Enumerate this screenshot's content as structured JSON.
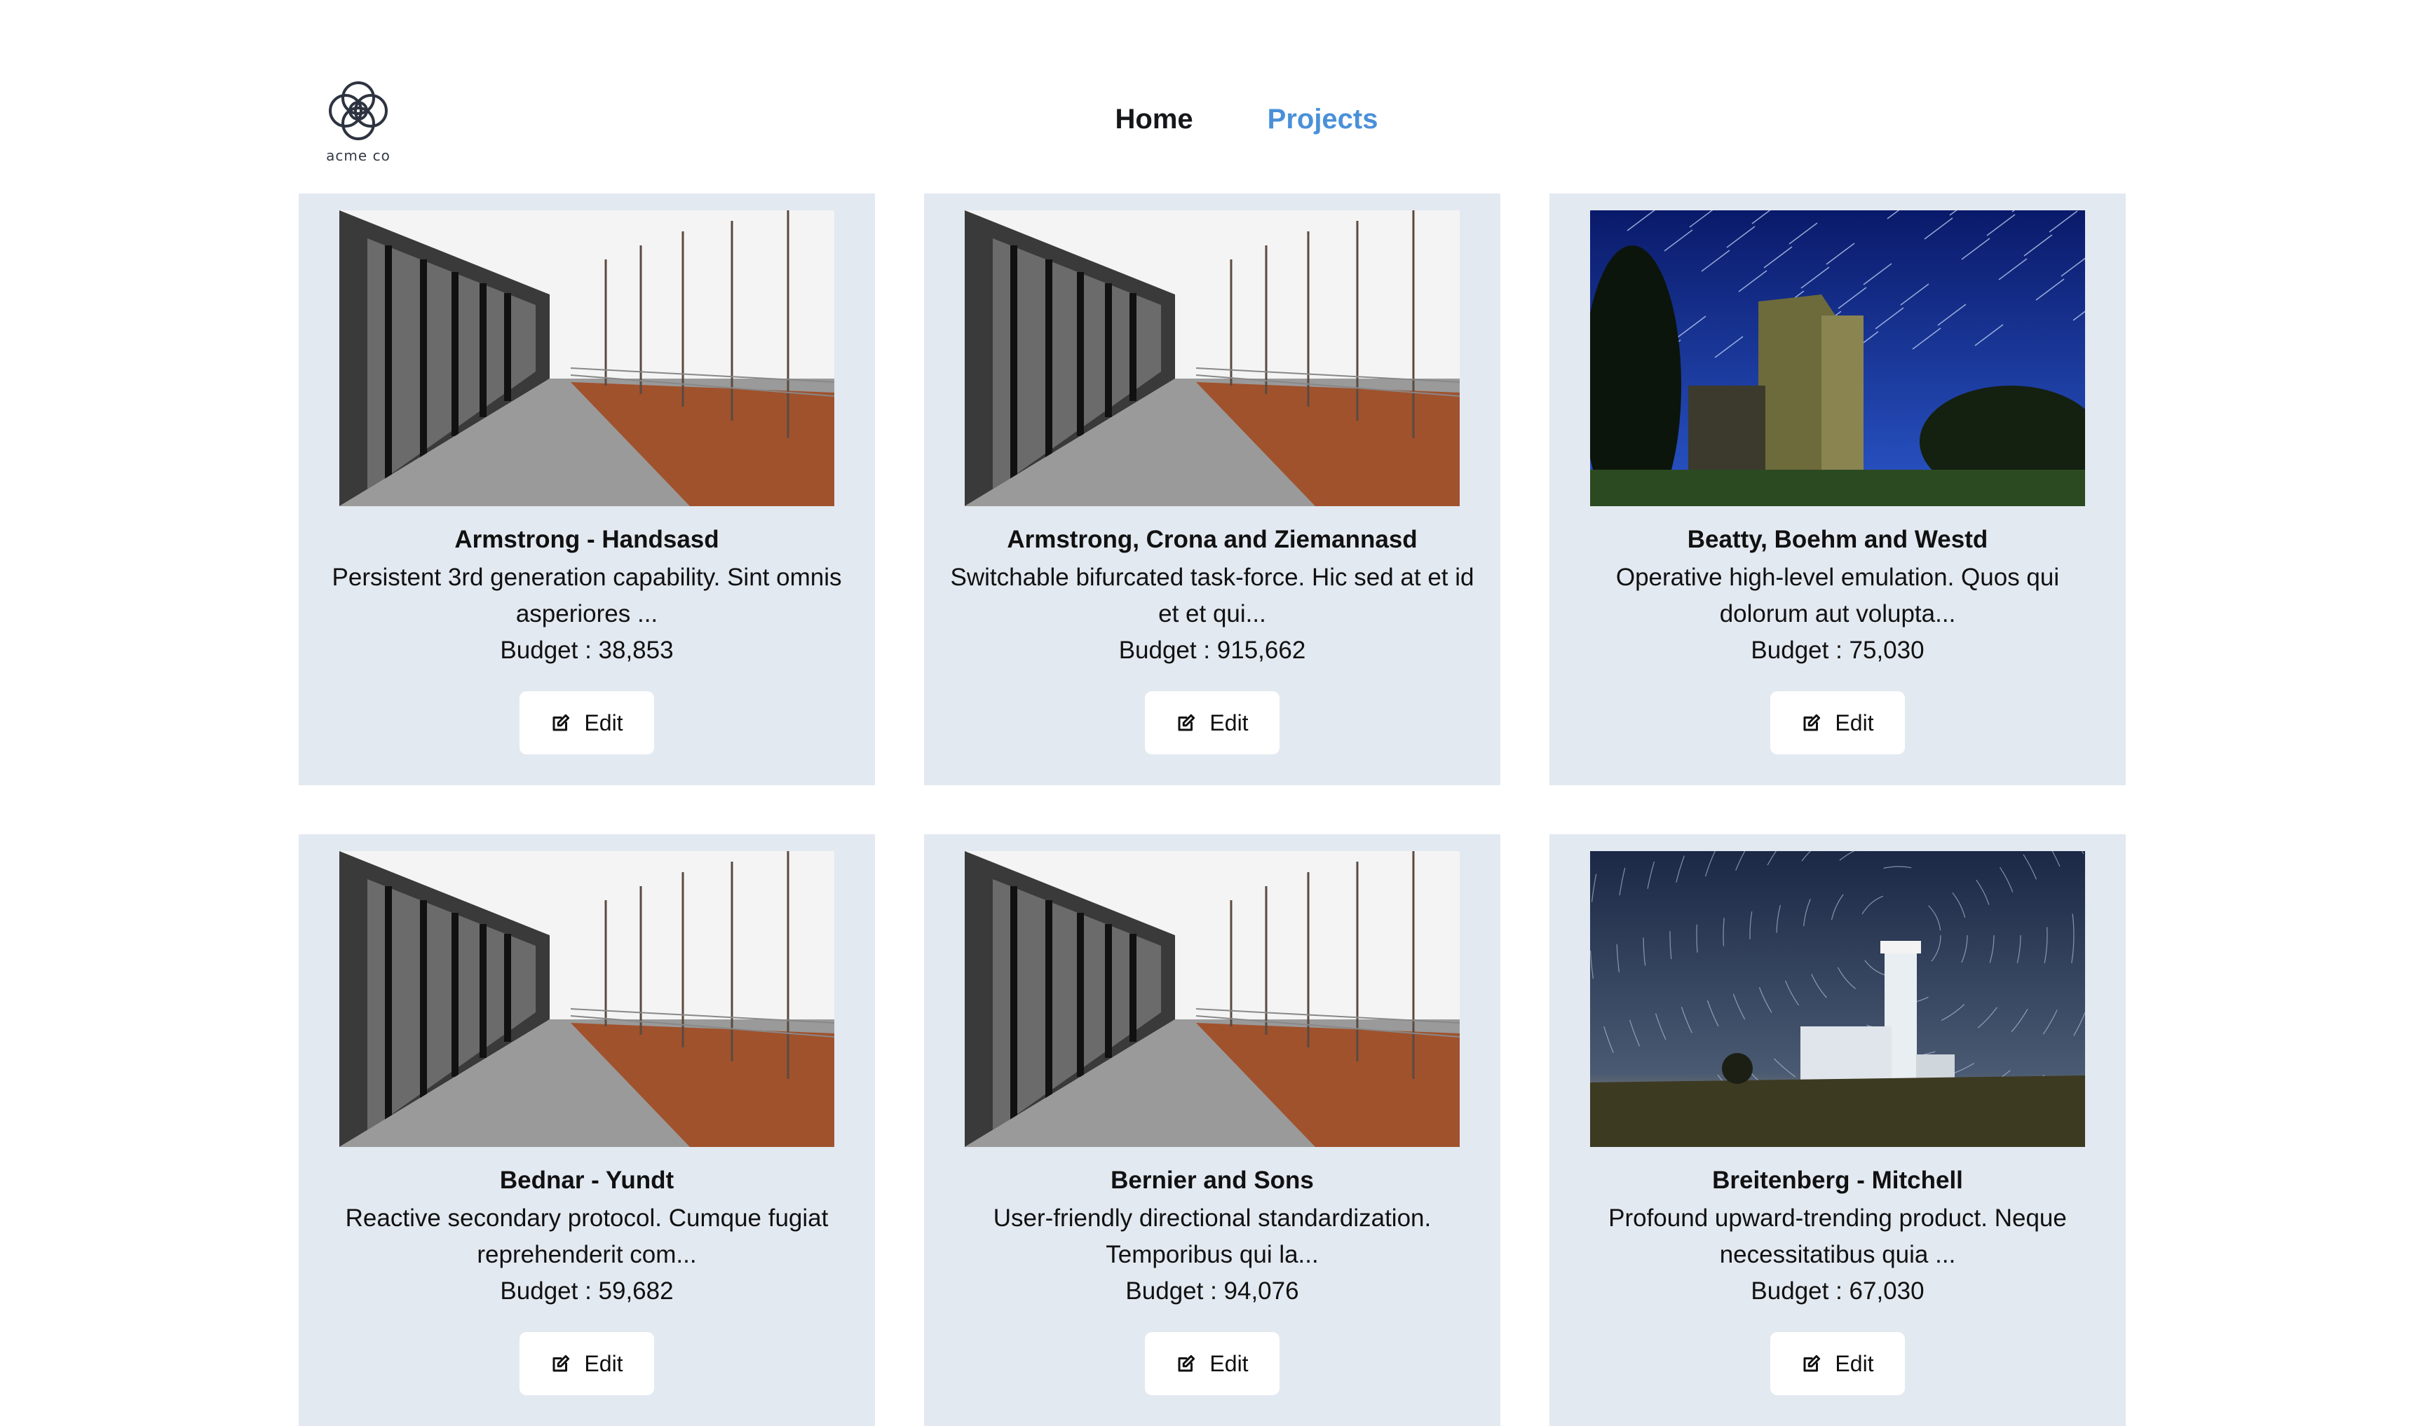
{
  "brand": {
    "logo_text": "acme co"
  },
  "nav": [
    {
      "label": "Home",
      "active": false
    },
    {
      "label": "Projects",
      "active": true
    }
  ],
  "projects": [
    {
      "title": "Armstrong - Handsasd",
      "desc": "Persistent 3rd generation capability. Sint omnis asperiores ...",
      "budget": "Budget : 38,853",
      "edit_label": "Edit",
      "image": "architecture"
    },
    {
      "title": "Armstrong, Crona and Ziemannasd",
      "desc": "Switchable bifurcated task-force. Hic sed at et id et et qui...",
      "budget": "Budget : 915,662",
      "edit_label": "Edit",
      "image": "architecture"
    },
    {
      "title": "Beatty, Boehm and Westd",
      "desc": "Operative high-level emulation. Quos qui dolorum aut volupta...",
      "budget": "Budget : 75,030",
      "edit_label": "Edit",
      "image": "tower-night"
    },
    {
      "title": "Bednar - Yundt",
      "desc": "Reactive secondary protocol. Cumque fugiat reprehenderit com...",
      "budget": "Budget : 59,682",
      "edit_label": "Edit",
      "image": "architecture"
    },
    {
      "title": "Bernier and Sons",
      "desc": "User-friendly directional standardization. Temporibus qui la...",
      "budget": "Budget : 94,076",
      "edit_label": "Edit",
      "image": "architecture"
    },
    {
      "title": "Breitenberg - Mitchell",
      "desc": "Profound upward-trending product. Neque necessitatibus quia ...",
      "budget": "Budget : 67,030",
      "edit_label": "Edit",
      "image": "lighthouse-night"
    }
  ]
}
